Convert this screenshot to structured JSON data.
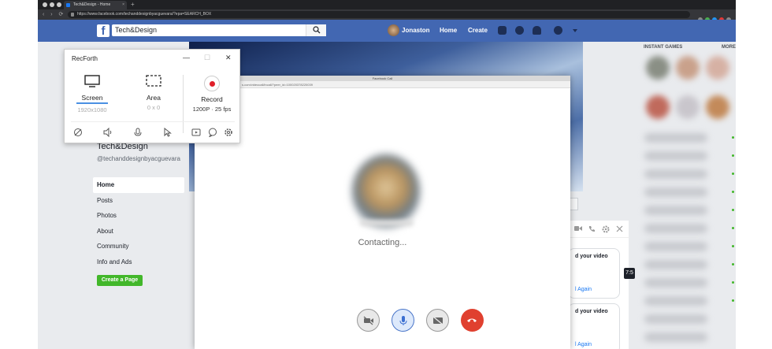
{
  "browser": {
    "tab_title": "Tech&Design - Home",
    "tab_close": "×",
    "new_tab": "+",
    "url": "https://www.facebook.com/techanddesignbyacguevara/?epa=SEARCH_BOX",
    "nav_arrows": "‹ › ⟳"
  },
  "facebook": {
    "logo": "f",
    "search_value": "Tech&Design",
    "user_name": "Jonaston",
    "nav_home": "Home",
    "nav_create": "Create"
  },
  "profile": {
    "name": "Tech&Design",
    "handle": "@techanddesignbyacguevara",
    "nav": [
      "Home",
      "Posts",
      "Photos",
      "About",
      "Community",
      "Info and Ads"
    ],
    "create_page": "Create a Page"
  },
  "games": {
    "title": "INSTANT GAMES",
    "more": "MORE"
  },
  "call_window": {
    "title": "Facebook Call",
    "url": "s.com/videocall/incall/?peer_id=100020378220039",
    "status": "Contacting..."
  },
  "chat": {
    "bubble1_title": "d your video",
    "bubble1_action": "l Again",
    "bubble2_title": "d your video",
    "bubble2_action": "l Again",
    "side_tag": "7:5",
    "partial_button": "e"
  },
  "recforth": {
    "title": "RecForth",
    "minimize": "—",
    "maximize": "☐",
    "close": "✕",
    "screen_label": "Screen",
    "screen_res": "1920x1080",
    "area_label": "Area",
    "area_res": "0 x 0",
    "record_label": "Record",
    "record_spec": "1200P · 25 fps"
  },
  "icons": [
    "search-icon",
    "friends-icon",
    "messenger-icon",
    "bell-icon",
    "help-icon",
    "dropdown-icon",
    "camera-off-icon",
    "speaker-icon",
    "mic-icon",
    "cursor-icon",
    "video-icon",
    "comment-icon",
    "gear-icon",
    "hangup-icon",
    "phone-icon",
    "close-icon"
  ],
  "colors": {
    "fb_blue": "#4267b2",
    "record_red": "#e0202a",
    "hangup_red": "#e0402f",
    "create_green": "#42b72a"
  }
}
